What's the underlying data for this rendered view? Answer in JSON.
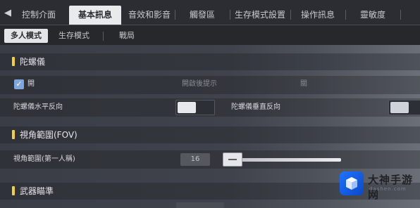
{
  "top_tabs": [
    {
      "label": "控制介面",
      "active": false
    },
    {
      "label": "基本訊息",
      "active": true
    },
    {
      "label": "音效和影音",
      "active": false
    },
    {
      "label": "觸發區",
      "active": false
    },
    {
      "label": "生存模式設置",
      "active": false
    },
    {
      "label": "操作訊息",
      "active": false
    },
    {
      "label": "靈敏度",
      "active": false
    }
  ],
  "sub_tabs": [
    {
      "label": "多人模式",
      "active": true
    },
    {
      "label": "生存模式",
      "active": false
    },
    {
      "label": "戰局",
      "active": false
    }
  ],
  "gyro_section": {
    "title": "陀螺儀",
    "enable_label": "開",
    "enable_checked": true,
    "hint_label": "開啟後提示",
    "off_label": "關",
    "horizontal_label": "陀螺儀水平反向",
    "vertical_label": "陀螺儀垂直反向"
  },
  "fov_section": {
    "title": "視角範圍(FOV)",
    "first_person_label": "視角範圍(第一人稱)",
    "first_person_value": "16"
  },
  "weapon_section": {
    "title": "武器瞄準"
  },
  "watermark": {
    "title": "大神手游网",
    "url": "dashen.com"
  },
  "colors": {
    "accent_yellow": "#f2d230",
    "checkbox_blue": "#7fa7dc",
    "logo_blue": "#1e73ff"
  }
}
